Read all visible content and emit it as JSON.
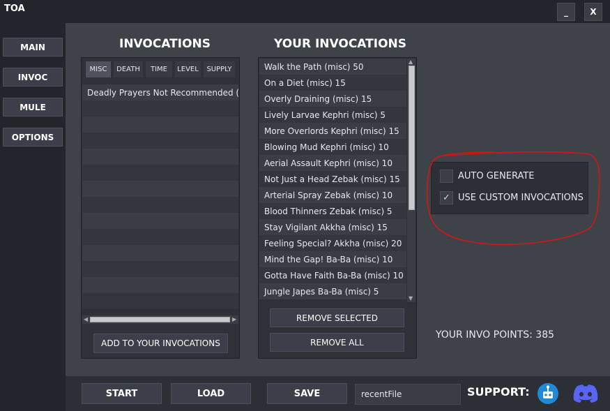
{
  "window": {
    "title": "TOA",
    "minimize_label": "_",
    "close_label": "X"
  },
  "sidebar": {
    "items": [
      {
        "label": "MAIN"
      },
      {
        "label": "INVOC"
      },
      {
        "label": "MULE"
      },
      {
        "label": "OPTIONS"
      }
    ]
  },
  "invocations": {
    "title": "INVOCATIONS",
    "tabs": [
      {
        "label": "MISC"
      },
      {
        "label": "DEATH"
      },
      {
        "label": "TIME"
      },
      {
        "label": "LEVEL"
      },
      {
        "label": "SUPPLY"
      }
    ],
    "active_tab": "MISC",
    "items": [
      "Deadly Prayers Not Recommended  (misc"
    ],
    "add_button": "ADD TO YOUR INVOCATIONS"
  },
  "your_invocations": {
    "title": "YOUR INVOCATIONS",
    "items": [
      "Walk the Path   (misc) 50",
      "On a Diet   (misc) 15",
      "Overly Draining   (misc) 15",
      "Lively Larvae Kephri  (misc) 5",
      "More Overlords Kephri  (misc) 15",
      "Blowing Mud Kephri  (misc) 10",
      "Aerial Assault Kephri  (misc) 10",
      "Not Just a Head Zebak  (misc) 15",
      "Arterial Spray Zebak  (misc) 10",
      "Blood Thinners Zebak  (misc) 5",
      "Stay Vigilant Akkha  (misc) 15",
      "Feeling Special? Akkha  (misc) 20",
      "Mind the Gap! Ba-Ba  (misc) 10",
      "Gotta Have Faith Ba-Ba  (misc) 10",
      "Jungle Japes Ba-Ba  (misc) 5"
    ],
    "remove_selected": "REMOVE SELECTED",
    "remove_all": "REMOVE ALL"
  },
  "options": {
    "auto_generate": {
      "label": "AUTO GENERATE",
      "checked": false
    },
    "use_custom": {
      "label": "USE CUSTOM INVOCATIONS",
      "checked": true,
      "check_glyph": "✓"
    }
  },
  "points": {
    "text": "YOUR INVO POINTS:  385"
  },
  "bottom": {
    "start": "START",
    "load": "LOAD",
    "save": "SAVE",
    "recent_file_value": "recentFile",
    "support_label": "SUPPORT:"
  },
  "colors": {
    "accent_circle": "#d41515",
    "discord": "#5865f2",
    "support_icon": "#1f8ad8"
  },
  "icons": {
    "support_1": "robot-icon",
    "support_2": "discord-icon"
  }
}
